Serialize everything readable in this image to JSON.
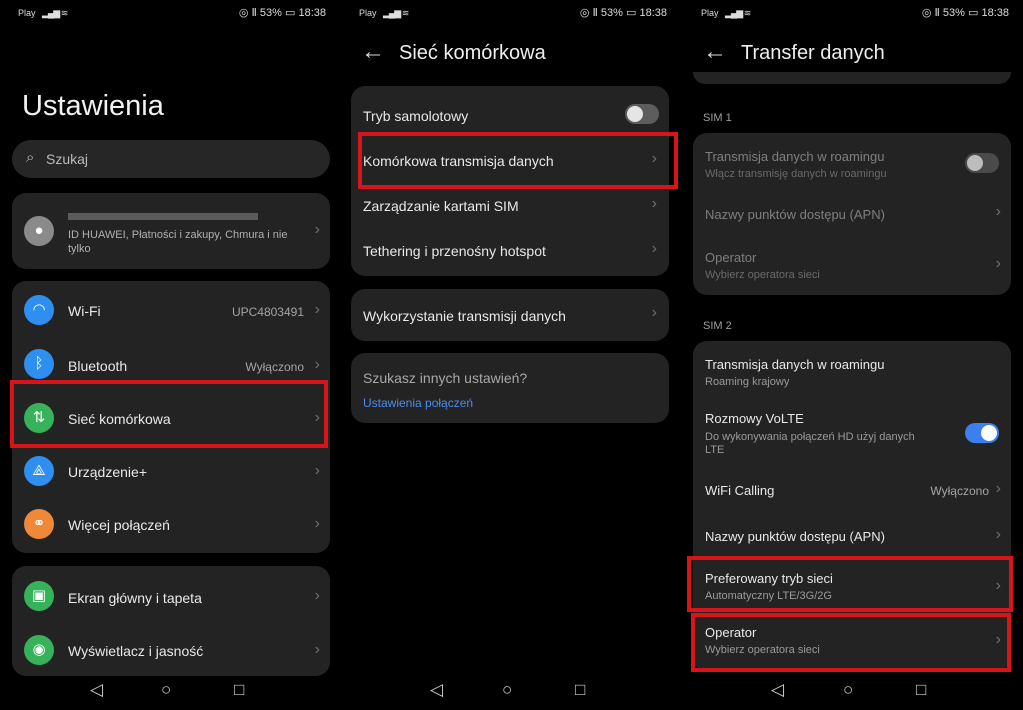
{
  "status": {
    "carrier": "Play",
    "right": "◎ Ⅱ 53% ▭ 18:38"
  },
  "nav": {
    "back": "◁",
    "home": "○",
    "recent": "□"
  },
  "panel1": {
    "title": "Ustawienia",
    "search_placeholder": "Szukaj",
    "account_sub": "ID HUAWEI, Płatności i zakupy, Chmura i nie tylko",
    "items": [
      {
        "label": "Wi-Fi",
        "value": "UPC4803491"
      },
      {
        "label": "Bluetooth",
        "value": "Wyłączono"
      },
      {
        "label": "Sieć komórkowa"
      },
      {
        "label": "Urządzenie+"
      },
      {
        "label": "Więcej połączeń"
      },
      {
        "label": "Ekran główny i tapeta"
      },
      {
        "label": "Wyświetlacz i jasność"
      }
    ]
  },
  "panel2": {
    "title": "Sieć komórkowa",
    "airplane": "Tryb samolotowy",
    "mobile_data": "Komórkowa transmisja danych",
    "sim_mgmt": "Zarządzanie kartami SIM",
    "tethering": "Tethering i przenośny hotspot",
    "usage": "Wykorzystanie transmisji danych",
    "other_q": "Szukasz innych ustawień?",
    "call_settings": "Ustawienia połączeń"
  },
  "panel3": {
    "title": "Transfer danych",
    "sim1": "SIM 1",
    "sim2": "SIM 2",
    "sim1_roaming": "Transmisja danych w roamingu",
    "sim1_roaming_sub": "Włącz transmisję danych w roamingu",
    "sim1_apn": "Nazwy punktów dostępu (APN)",
    "sim1_operator": "Operator",
    "sim1_operator_sub": "Wybierz operatora sieci",
    "sim2_roaming": "Transmisja danych w roamingu",
    "sim2_roaming_sub": "Roaming krajowy",
    "volte": "Rozmowy VoLTE",
    "volte_sub1": "Do wykonywania połączeń HD użyj danych",
    "volte_sub2": "LTE",
    "wifi_calling": "WiFi Calling",
    "wifi_calling_value": "Wyłączono",
    "sim2_apn": "Nazwy punktów dostępu (APN)",
    "pref_mode": "Preferowany tryb sieci",
    "pref_mode_sub": "Automatyczny LTE/3G/2G",
    "sim2_operator": "Operator",
    "sim2_operator_sub": "Wybierz operatora sieci"
  }
}
